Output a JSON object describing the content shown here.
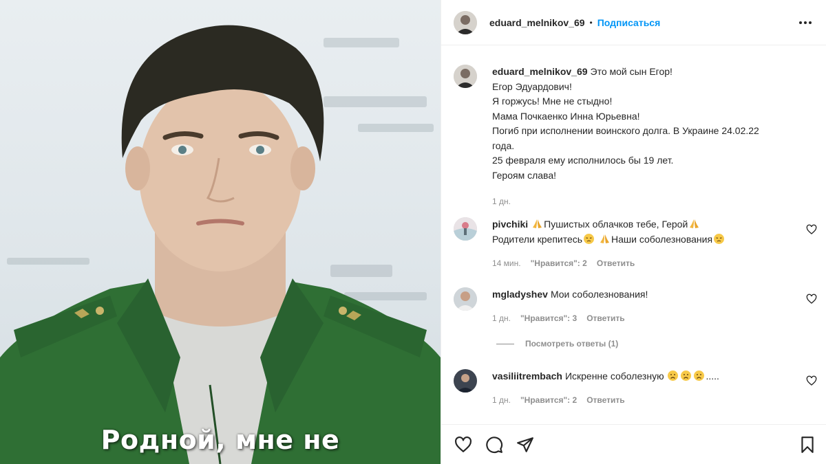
{
  "photo": {
    "caption": "Родной, мне не"
  },
  "header": {
    "username": "eduard_melnikov_69",
    "separator": "•",
    "follow_label": "Подписаться"
  },
  "post": {
    "username": "eduard_melnikov_69",
    "lines": [
      "Это мой сын Егор!",
      "Егор Эдуардович!",
      "Я горжусь! Мне не стыдно!",
      "Мама Почкаенко Инна Юрьевна!",
      "Погиб при исполнении воинского долга. В Украине 24.02.22",
      "года.",
      "25 февраля ему исполнилось бы 19 лет.",
      "Героям слава!"
    ],
    "time": "1 дн."
  },
  "comments": [
    {
      "username": "pivchiki",
      "line1_a": "Пушистых облачков тебе, Герой",
      "line2_a": "Родители крепитесь",
      "line2_b": "Наши соболезнования",
      "time": "14 мин.",
      "likes": "\"Нравится\": 2",
      "reply": "Ответить"
    },
    {
      "username": "mgladyshev",
      "text": "Мои соболезнования!",
      "time": "1 дн.",
      "likes": "\"Нравится\": 3",
      "reply": "Ответить",
      "view_replies": "Посмотреть ответы (1)"
    },
    {
      "username": "vasiliitrembach",
      "text": "Искренне соболезную",
      "text_tail": ".....",
      "time": "1 дн.",
      "likes": "\"Нравится\": 2",
      "reply": "Ответить"
    }
  ],
  "icons": {
    "more": "more-icon",
    "like": "heart-icon",
    "comment": "comment-icon",
    "share": "share-icon",
    "save": "bookmark-icon"
  },
  "colors": {
    "accent": "#0095f6",
    "text": "#262626",
    "muted": "#8e8e8e",
    "divider": "#efefef"
  }
}
